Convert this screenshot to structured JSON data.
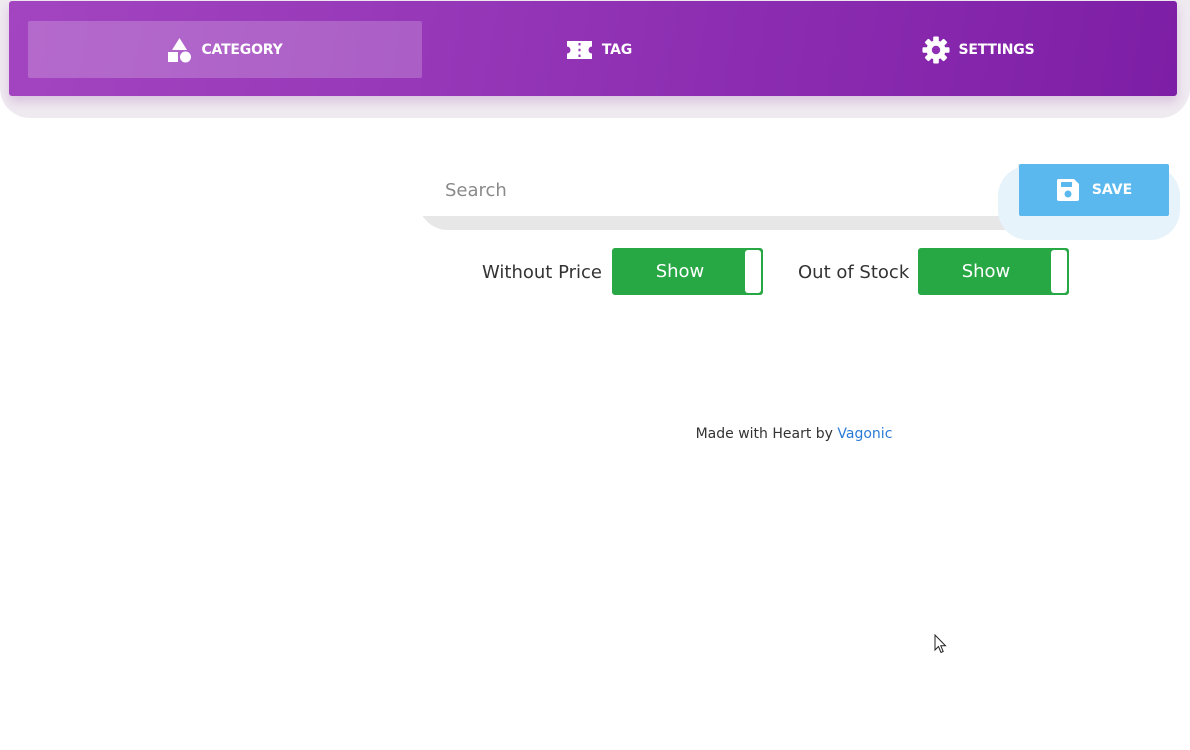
{
  "nav": {
    "tabs": [
      {
        "label": "CATEGORY",
        "icon": "shapes-icon",
        "active": true
      },
      {
        "label": "TAG",
        "icon": "ticket-icon",
        "active": false
      },
      {
        "label": "SETTINGS",
        "icon": "gear-icon",
        "active": false
      }
    ]
  },
  "toolbar": {
    "search_placeholder": "Search",
    "search_value": "",
    "save_label": "SAVE",
    "save_icon": "floppy-disk-icon"
  },
  "filters": {
    "without_price": {
      "label": "Without Price",
      "toggle_label": "Show"
    },
    "out_of_stock": {
      "label": "Out of Stock",
      "toggle_label": "Show"
    }
  },
  "footer": {
    "text": "Made with Heart by ",
    "link_text": "Vagonic"
  },
  "colors": {
    "nav_gradient_start": "#a345c0",
    "nav_gradient_end": "#7d1ea6",
    "save_button": "#5bb8ee",
    "toggle_on": "#28a745",
    "link": "#2b7bd6"
  }
}
